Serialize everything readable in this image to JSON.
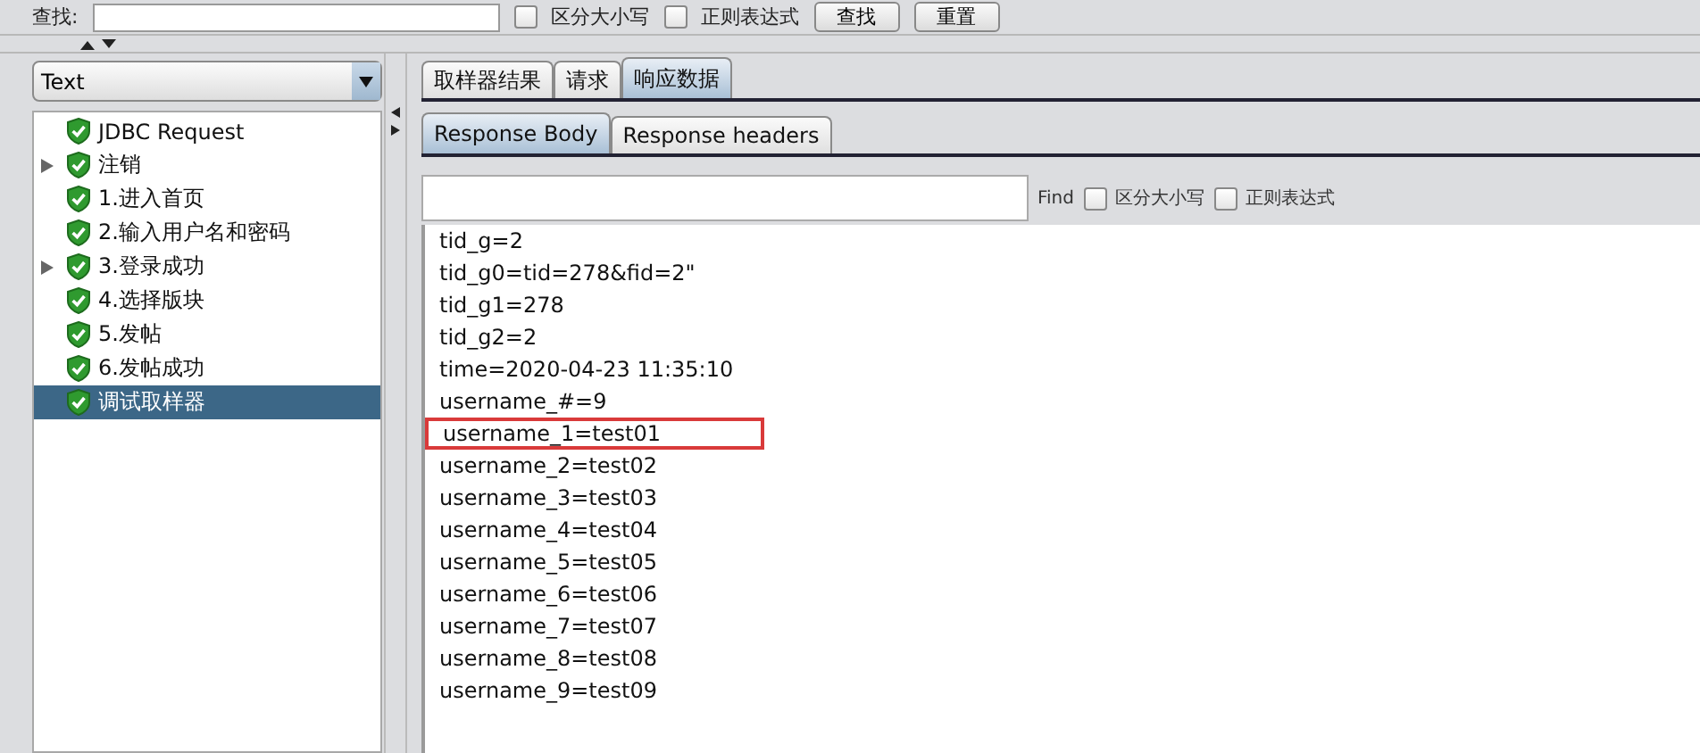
{
  "search_bar": {
    "label": "查找:",
    "options": [
      {
        "label": "区分大小写",
        "checked": false
      },
      {
        "label": "正则表达式",
        "checked": false
      }
    ],
    "buttons": [
      "查找",
      "重置"
    ]
  },
  "view_select": {
    "value": "Text"
  },
  "tree": [
    {
      "label": "JDBC Request",
      "selected": false
    },
    {
      "label": "注销",
      "expanded": false,
      "selected": false
    },
    {
      "label": "1.进入首页",
      "selected": false
    },
    {
      "label": "2.输入用户名和密码",
      "selected": false
    },
    {
      "label": "3.登录成功",
      "expanded": false,
      "selected": false
    },
    {
      "label": "4.选择版块",
      "selected": false
    },
    {
      "label": "5.发帖",
      "selected": false
    },
    {
      "label": "6.发帖成功",
      "selected": false
    },
    {
      "label": "调试取样器",
      "selected": true
    }
  ],
  "tabs": [
    {
      "label": "取样器结果",
      "selected": false
    },
    {
      "label": "请求",
      "selected": false
    },
    {
      "label": "响应数据",
      "selected": true
    }
  ],
  "sub_tabs": [
    {
      "label": "Response Body",
      "selected": true
    },
    {
      "label": "Response headers",
      "selected": false
    }
  ],
  "find": {
    "label": "Find",
    "options": [
      {
        "label": "区分大小写",
        "checked": false
      },
      {
        "label": "正则表达式",
        "checked": false
      }
    ]
  },
  "lines": [
    {
      "text": "tid_g=2",
      "highlighted": false
    },
    {
      "text": "tid_g0=tid=278&fid=2\"",
      "highlighted": false
    },
    {
      "text": "tid_g1=278",
      "highlighted": false
    },
    {
      "text": "tid_g2=2",
      "highlighted": false
    },
    {
      "text": "time=2020-04-23 11:35:10",
      "highlighted": false
    },
    {
      "text": "username_#=9",
      "highlighted": false
    },
    {
      "text": "username_1=test01",
      "highlighted": true
    },
    {
      "text": "username_2=test02",
      "highlighted": false
    },
    {
      "text": "username_3=test03",
      "highlighted": false
    },
    {
      "text": "username_4=test04",
      "highlighted": false
    },
    {
      "text": "username_5=test05",
      "highlighted": false
    },
    {
      "text": "username_6=test06",
      "highlighted": false
    },
    {
      "text": "username_7=test07",
      "highlighted": false
    },
    {
      "text": "username_8=test08",
      "highlighted": false
    },
    {
      "text": "username_9=test09",
      "highlighted": false
    }
  ]
}
